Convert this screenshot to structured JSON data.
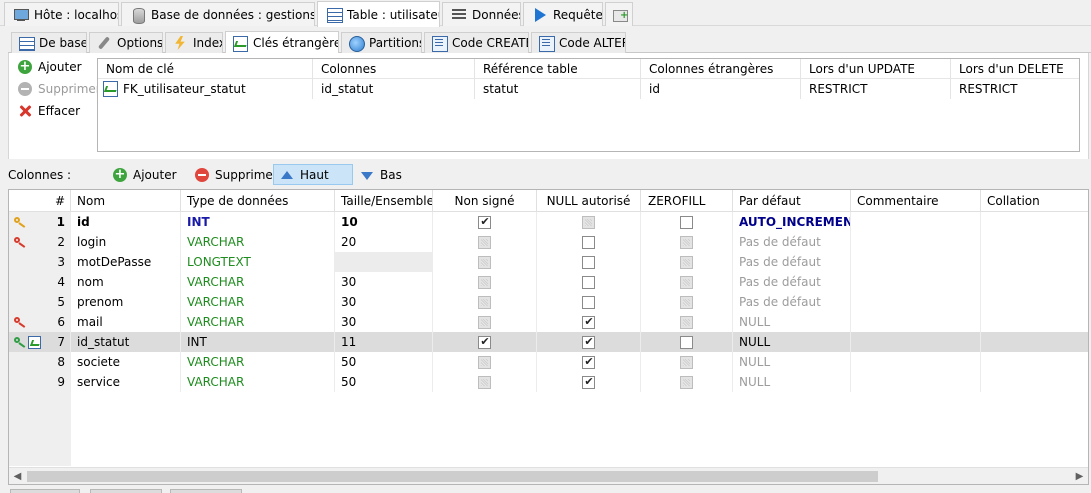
{
  "top_tabs": [
    {
      "label": "Hôte : localhost",
      "icon": "host-icon"
    },
    {
      "label": "Base de données : gestionstock",
      "icon": "database-icon"
    },
    {
      "label": "Table : utilisateur",
      "icon": "table-icon"
    },
    {
      "label": "Données",
      "icon": "data-grid-icon"
    },
    {
      "label": "Requête*",
      "icon": "play-icon"
    },
    {
      "label": "",
      "icon": "new-query-icon"
    }
  ],
  "sub_tabs": [
    {
      "label": "De base",
      "icon": "table-icon"
    },
    {
      "label": "Options",
      "icon": "wrench-icon"
    },
    {
      "label": "Index",
      "icon": "lightning-icon"
    },
    {
      "label": "Clés étrangères",
      "icon": "foreign-key-icon"
    },
    {
      "label": "Partitions",
      "icon": "globe-icon"
    },
    {
      "label": "Code CREATE",
      "icon": "code-icon"
    },
    {
      "label": "Code ALTER",
      "icon": "code-icon"
    }
  ],
  "fk_panel": {
    "add_label": "Ajouter",
    "remove_label": "Supprimer",
    "clear_label": "Effacer",
    "headers": [
      "Nom de clé",
      "Colonnes",
      "Référence table",
      "Colonnes étrangères",
      "Lors d'un UPDATE",
      "Lors d'un DELETE"
    ],
    "rows": [
      [
        "FK_utilisateur_statut",
        "id_statut",
        "statut",
        "id",
        "RESTRICT",
        "RESTRICT"
      ]
    ]
  },
  "columns_toolbar": {
    "label": "Colonnes :",
    "add_label": "Ajouter",
    "remove_label": "Supprimer",
    "up_label": "Haut",
    "down_label": "Bas"
  },
  "columns_grid": {
    "headers": [
      "#",
      "Nom",
      "Type de données",
      "Taille/Ensemble",
      "Non signé",
      "NULL autorisé",
      "ZEROFILL",
      "Par défaut",
      "Commentaire",
      "Collation"
    ],
    "rows": [
      {
        "num": "1",
        "name": "id",
        "type": "INT",
        "size": "10",
        "unsigned": true,
        "nullable": false,
        "zerofill": false,
        "default": "AUTO_INCREMENT",
        "key": "primary"
      },
      {
        "num": "2",
        "name": "login",
        "type": "VARCHAR",
        "size": "20",
        "unsigned": false,
        "nullable": false,
        "zerofill": false,
        "default": "Pas de défaut",
        "key": "unique"
      },
      {
        "num": "3",
        "name": "motDePasse",
        "type": "LONGTEXT",
        "size": "",
        "unsigned": false,
        "nullable": false,
        "zerofill": false,
        "default": "Pas de défaut",
        "key": ""
      },
      {
        "num": "4",
        "name": "nom",
        "type": "VARCHAR",
        "size": "30",
        "unsigned": false,
        "nullable": false,
        "zerofill": false,
        "default": "Pas de défaut",
        "key": ""
      },
      {
        "num": "5",
        "name": "prenom",
        "type": "VARCHAR",
        "size": "30",
        "unsigned": false,
        "nullable": false,
        "zerofill": false,
        "default": "Pas de défaut",
        "key": ""
      },
      {
        "num": "6",
        "name": "mail",
        "type": "VARCHAR",
        "size": "30",
        "unsigned": false,
        "nullable": true,
        "zerofill": false,
        "default": "NULL",
        "key": "unique"
      },
      {
        "num": "7",
        "name": "id_statut",
        "type": "INT",
        "size": "11",
        "unsigned": true,
        "nullable": true,
        "zerofill": false,
        "default": "NULL",
        "key": "foreign"
      },
      {
        "num": "8",
        "name": "societe",
        "type": "VARCHAR",
        "size": "50",
        "unsigned": false,
        "nullable": true,
        "zerofill": false,
        "default": "NULL",
        "key": ""
      },
      {
        "num": "9",
        "name": "service",
        "type": "VARCHAR",
        "size": "50",
        "unsigned": false,
        "nullable": true,
        "zerofill": false,
        "default": "NULL",
        "key": ""
      }
    ]
  },
  "colors": {
    "type_string": "#1e8c1e",
    "type_int": "#1a1aa8",
    "default_muted": "#9c9c9c",
    "default_auto_increment": "#00008b",
    "selected_row": "#dcdcdc",
    "accent_blue": "#3a78c8"
  }
}
